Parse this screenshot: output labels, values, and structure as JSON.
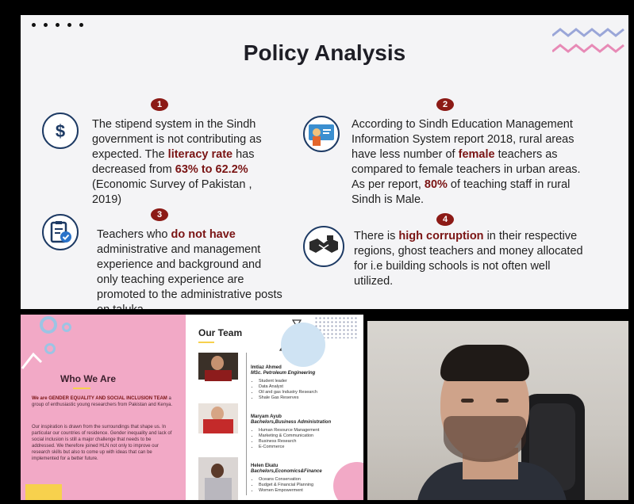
{
  "slide": {
    "title": "Policy Analysis",
    "points": [
      {
        "number": "1",
        "icon": "dollar-icon",
        "t1": "The stipend system in the Sindh government is not contributing as expected. The ",
        "b1": "literacy rate",
        "t2": " has decreased from ",
        "b2": "63% to 62.2%",
        "t3": " (Economic Survey of Pakistan , 2019)"
      },
      {
        "number": "2",
        "icon": "teacher-icon",
        "t1": "According to Sindh Education Management Information System report 2018, rural areas have less number of ",
        "b1": "female",
        "t2": " teachers as compared to female teachers in urban areas. As per report, ",
        "b2": "80%",
        "t3": " of teaching staff in rural Sindh is Male."
      },
      {
        "number": "3",
        "icon": "checklist-icon",
        "t1": "Teachers who ",
        "b1": "do not have",
        "t2": " administrative and management experience and background and only teaching experience are promoted to the administrative posts on taluka."
      },
      {
        "number": "4",
        "icon": "handshake-icon",
        "t1": "There is ",
        "b1": "high corruption",
        "t2": " in their respective regions, ghost teachers and money allocated for i.e building schools is not often well utilized."
      }
    ]
  },
  "pink": {
    "heading": "Who We Are",
    "p1_bold": "We are GENDER EQUALITY AND SOCIAL INCLUSION TEAM",
    "p1_rest": " a group of enthusiastic young researchers from Pakistan and Kenya.",
    "p2": "Our inspiration is drawn from the surroundings that shape us. In particular our countries of residence. Gender inequality and lack of social inclusion is still a major challenge that needs to be addressed. We therefore joined HLN not only to improve our research skills but also to come up with ideas that can be implemented for a better future."
  },
  "team": {
    "heading": "Our Team",
    "members": [
      {
        "name": "Imtiaz Ahmed",
        "role": "MSc. Petroleum Engineering",
        "items": [
          "Student leader",
          "Data Analyst",
          "Oil and gas Industry Research",
          "Shale Gas Reserves"
        ]
      },
      {
        "name": "Maryam Ayub",
        "role": "Bachelors,Business Administration",
        "items": [
          "Human Resource Management",
          "Marketing & Communication",
          "Business Research",
          "E-Commerce"
        ]
      },
      {
        "name": "Helen Ekatu",
        "role": "Bachelors,Economics&Finance",
        "items": [
          "Oceans Conservation",
          "Budget & Financial Planning",
          "Women Empowerment"
        ]
      }
    ]
  },
  "colors": {
    "accent": "#8c1a16",
    "navy": "#1d3a64",
    "pink": "#f2a9c6",
    "slide_bg": "#f4f4f6"
  }
}
